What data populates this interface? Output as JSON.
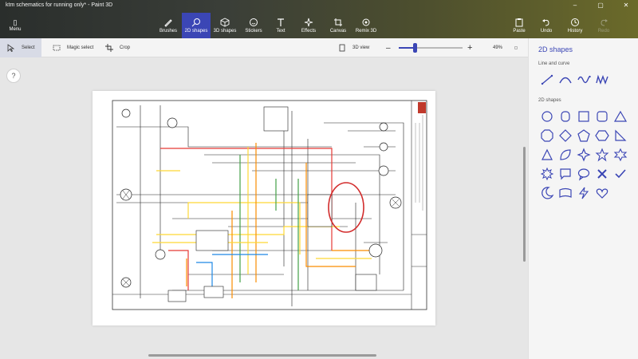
{
  "window": {
    "title": "ktm schematics for running only* - Paint 3D"
  },
  "menu": {
    "label": "Menu"
  },
  "toolbar": {
    "tools": [
      {
        "label": "Brushes"
      },
      {
        "label": "2D shapes"
      },
      {
        "label": "3D shapes"
      },
      {
        "label": "Stickers"
      },
      {
        "label": "Text"
      },
      {
        "label": "Effects"
      },
      {
        "label": "Canvas"
      },
      {
        "label": "Remix 3D"
      }
    ],
    "right": [
      {
        "label": "Paste"
      },
      {
        "label": "Undo"
      },
      {
        "label": "History"
      },
      {
        "label": "Redo"
      }
    ]
  },
  "commandbar": {
    "select": "Select",
    "magic_select": "Magic select",
    "crop": "Crop",
    "view_3d": "3D view",
    "zoom_pct": "49%",
    "zoom_level": 0.25
  },
  "help": {
    "label": "?"
  },
  "panel": {
    "title": "2D shapes",
    "line_section": "Line and curve",
    "shapes_section": "2D shapes",
    "lines": [
      "line-icon",
      "curve-icon",
      "wave-icon",
      "squiggle-icon"
    ],
    "shapes": [
      "circle",
      "rounded-octagon",
      "square",
      "rounded-square",
      "triangle",
      "octagon",
      "diamond",
      "pentagon",
      "hexagon",
      "right-triangle",
      "triangle-up",
      "leaf",
      "star-4",
      "star-5",
      "star-6",
      "burst",
      "speech-square",
      "speech-round",
      "x-mark",
      "check-mark",
      "moon",
      "banner",
      "lightning",
      "heart"
    ]
  },
  "colors": {
    "accent": "#3b46b5",
    "annotation": "#d22b2b"
  }
}
